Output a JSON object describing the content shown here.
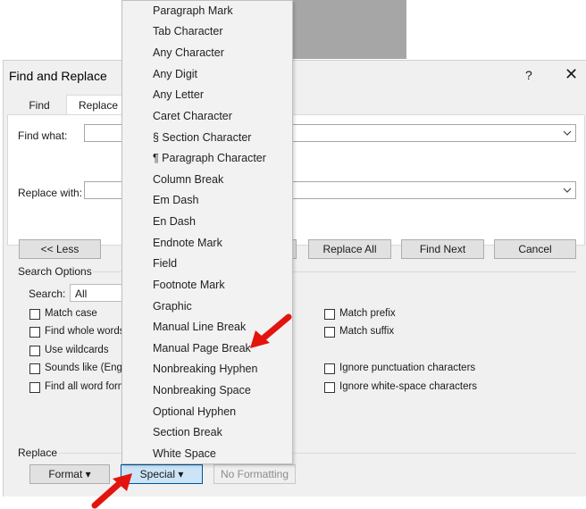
{
  "dialog": {
    "title": "Find and Replace",
    "help": "?",
    "close": "✕",
    "tabs": [
      {
        "label": "Find"
      },
      {
        "label": "Replace"
      }
    ],
    "find_label": "Find what:",
    "find_value": "",
    "replace_label": "Replace with:",
    "replace_value": "",
    "less_button": "<< Less",
    "replace_all_button": "Replace All",
    "find_next_button": "Find Next",
    "cancel_button": "Cancel",
    "search_options_label": "Search Options",
    "search_label": "Search:",
    "search_value": "All",
    "options_left": [
      "Match case",
      "Find whole words",
      "Use wildcards",
      "Sounds like (Englis",
      "Find all word form"
    ],
    "options_right": [
      "Match prefix",
      "Match suffix",
      "Ignore punctuation characters",
      "Ignore white-space characters"
    ],
    "replace_section_label": "Replace",
    "format_button": "Format ▾",
    "special_button": "Special ▾",
    "no_formatting_button": "No Formatting"
  },
  "special_menu": {
    "items": [
      "Paragraph Mark",
      "Tab Character",
      "Any Character",
      "Any Digit",
      "Any Letter",
      "Caret Character",
      "§ Section Character",
      "¶ Paragraph Character",
      "Column Break",
      "Em Dash",
      "En Dash",
      "Endnote Mark",
      "Field",
      "Footnote Mark",
      "Graphic",
      "Manual Line Break",
      "Manual Page Break",
      "Nonbreaking Hyphen",
      "Nonbreaking Space",
      "Optional Hyphen",
      "Section Break",
      "White Space"
    ]
  },
  "colors": {
    "annotation_arrow": "#e3140e",
    "special_button_bg": "#cce4f7",
    "special_button_border": "#005499"
  }
}
